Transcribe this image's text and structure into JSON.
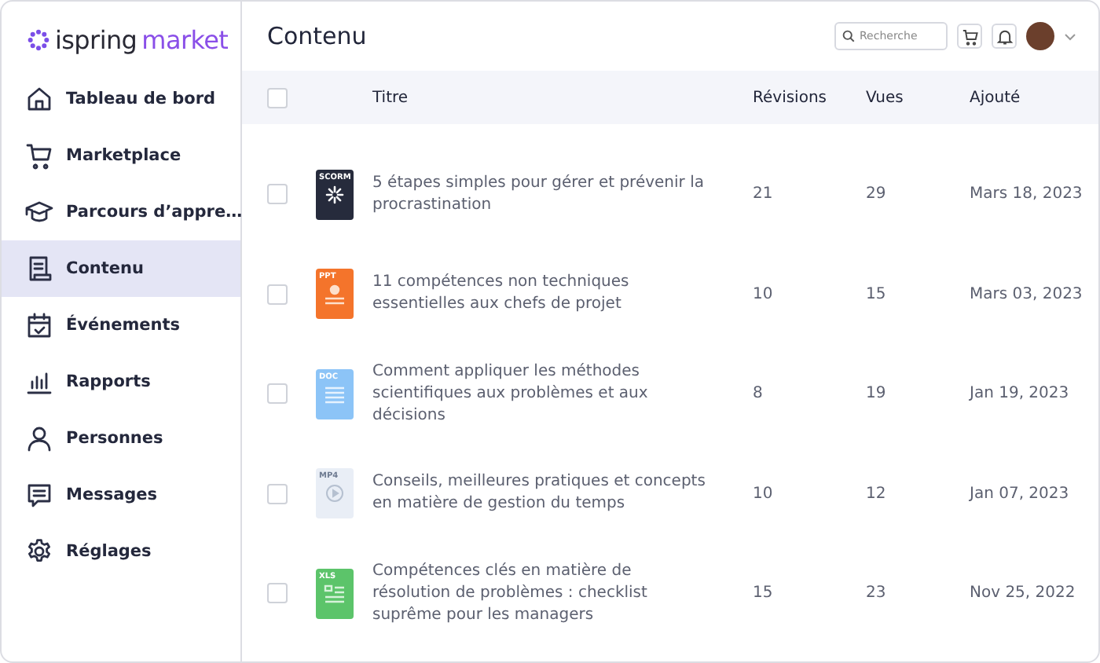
{
  "logo": {
    "brand": "ispring",
    "product": "market"
  },
  "sidebar": {
    "items": [
      {
        "kind": "home",
        "label": "Tableau de bord",
        "selected": false
      },
      {
        "kind": "cart",
        "label": "Marketplace",
        "selected": false
      },
      {
        "kind": "cap",
        "label": "Parcours d’appre…",
        "selected": false
      },
      {
        "kind": "doc",
        "label": "Contenu",
        "selected": true
      },
      {
        "kind": "calendar",
        "label": "Événements",
        "selected": false
      },
      {
        "kind": "bars",
        "label": "Rapports",
        "selected": false
      },
      {
        "kind": "person",
        "label": "Personnes",
        "selected": false
      },
      {
        "kind": "message",
        "label": "Messages",
        "selected": false
      },
      {
        "kind": "gear",
        "label": "Réglages",
        "selected": false
      }
    ]
  },
  "page_title": "Contenu",
  "search": {
    "placeholder": "Recherche"
  },
  "table": {
    "columns": [
      "Titre",
      "Révisions",
      "Vues",
      "Ajouté"
    ],
    "header_checked": false,
    "rows": [
      {
        "kind": "scorm",
        "file_label": "SCORM",
        "title": "5 étapes simples pour gérer et prévenir la procrastination",
        "revisions": "21",
        "views": "29",
        "added": "Mars 18, 2023",
        "checked": false
      },
      {
        "kind": "ppt",
        "file_label": "PPT",
        "title": "11 compétences non techniques essentielles aux chefs de projet",
        "revisions": "10",
        "views": "15",
        "added": "Mars 03, 2023",
        "checked": false
      },
      {
        "kind": "doc",
        "file_label": "DOC",
        "title": "Comment appliquer les méthodes scientifiques aux problèmes et aux décisions",
        "revisions": "8",
        "views": "19",
        "added": "Jan 19, 2023",
        "checked": false
      },
      {
        "kind": "mp4",
        "file_label": "MP4",
        "title": "Conseils, meilleures pratiques et concepts en matière de gestion du temps",
        "revisions": "10",
        "views": "12",
        "added": "Jan 07, 2023",
        "checked": false
      },
      {
        "kind": "xls",
        "file_label": "XLS",
        "title": "Compétences clés en matière de résolution de problèmes : checklist suprême pour les managers",
        "revisions": "15",
        "views": "23",
        "added": "Nov 25, 2022",
        "checked": false
      }
    ]
  }
}
